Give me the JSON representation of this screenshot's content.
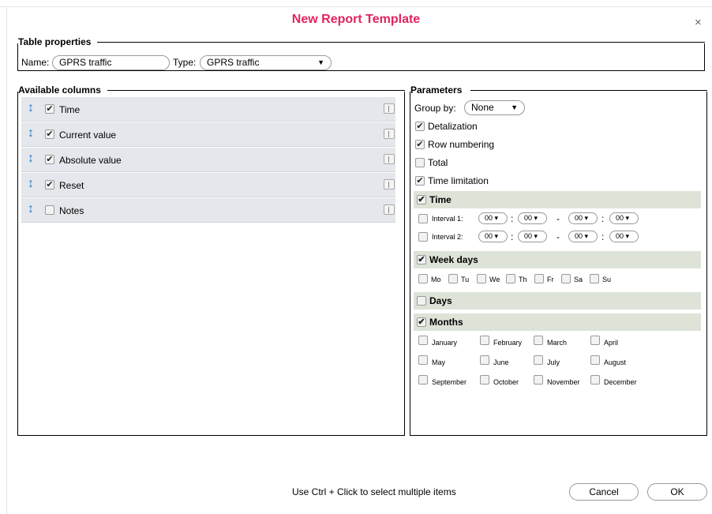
{
  "dialog": {
    "title": "New Report Template",
    "close": "×"
  },
  "table_properties": {
    "legend": "Table properties",
    "name_label": "Name:",
    "name_value": "GPRS traffic",
    "type_label": "Type:",
    "type_value": "GPRS traffic"
  },
  "available_columns": {
    "legend": "Available columns",
    "items": [
      {
        "label": "Time",
        "checked": true
      },
      {
        "label": "Current value",
        "checked": true
      },
      {
        "label": "Absolute value",
        "checked": true
      },
      {
        "label": "Reset",
        "checked": true
      },
      {
        "label": "Notes",
        "checked": false
      }
    ]
  },
  "parameters": {
    "legend": "Parameters",
    "group_by_label": "Group by:",
    "group_by_value": "None",
    "detalization": "Detalization",
    "row_numbering": "Row numbering",
    "total": "Total",
    "time_limitation": "Time limitation",
    "time_header": "Time",
    "interval1": "Interval 1:",
    "interval2": "Interval 2:",
    "time_value": "00",
    "colon": ":",
    "dash": "-",
    "week_days_header": "Week days",
    "week_days": [
      "Mo",
      "Tu",
      "We",
      "Th",
      "Fr",
      "Sa",
      "Su"
    ],
    "days_header": "Days",
    "months_header": "Months",
    "months": [
      "January",
      "February",
      "March",
      "April",
      "May",
      "June",
      "July",
      "August",
      "September",
      "October",
      "November",
      "December"
    ]
  },
  "footer": {
    "hint": "Use Ctrl + Click to select multiple items",
    "cancel": "Cancel",
    "ok": "OK"
  },
  "colors": {
    "title": "#e0245e",
    "drag_icon": "#2a7dc9",
    "row_bg": "#e4e7eb",
    "section_bg": "#dde3d7"
  }
}
